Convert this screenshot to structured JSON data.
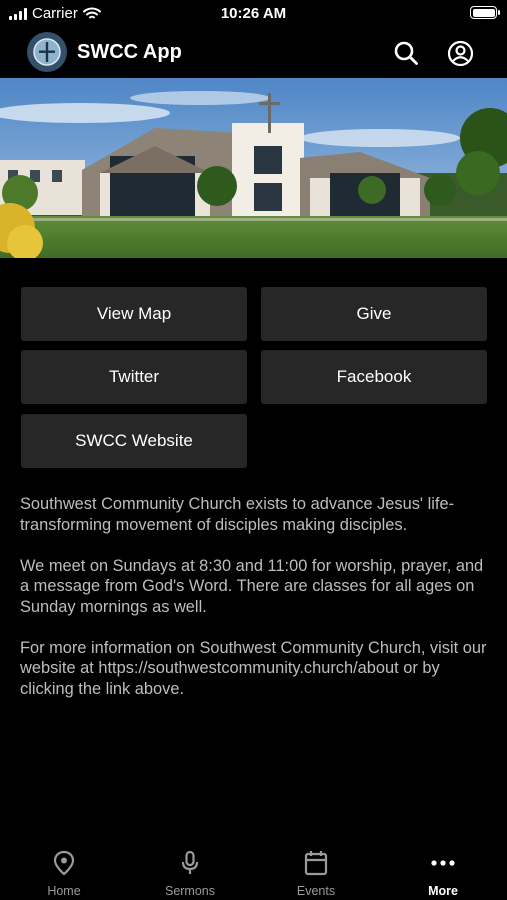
{
  "status_bar": {
    "carrier": "Carrier",
    "time": "10:26 AM"
  },
  "header": {
    "title": "SWCC App",
    "icons": [
      "search-icon",
      "profile-icon"
    ]
  },
  "hero": {
    "alt": "church-photo"
  },
  "buttons": [
    {
      "label": "View Map"
    },
    {
      "label": "Give"
    },
    {
      "label": "Twitter"
    },
    {
      "label": "Facebook"
    },
    {
      "label": "SWCC Website"
    }
  ],
  "description": {
    "paragraphs": [
      "Southwest Community Church exists to advance Jesus' life-transforming movement of disciples making disciples.",
      "We meet on Sundays at 8:30 and 11:00 for worship, prayer, and a message from God's Word. There are classes for all ages on Sunday mornings as well.",
      "For more information on Southwest Community Church, visit our website at https://southwestcommunity.church/about or by clicking the link above."
    ]
  },
  "tabs": [
    {
      "label": "Home",
      "icon": "location-pin-icon"
    },
    {
      "label": "Sermons",
      "icon": "microphone-icon"
    },
    {
      "label": "Events",
      "icon": "calendar-icon"
    },
    {
      "label": "More",
      "icon": "more-dots-icon",
      "active": true
    }
  ],
  "colors": {
    "background": "#000000",
    "button": "#272727",
    "text_muted": "#bdbdbd",
    "tab_inactive": "#9a9a9a"
  }
}
